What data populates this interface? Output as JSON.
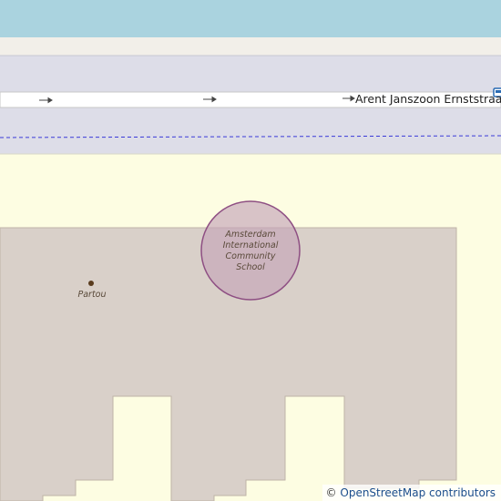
{
  "map": {
    "colors": {
      "water": "#aad3df",
      "road_casing": "#f0eee9",
      "road_band": "#dddde8",
      "street": "#ffffff",
      "railway_dash": "#3a3ad8",
      "residential": "#fdfde2",
      "school_area": "#d9d0c9",
      "school_marker": "#c5a4b8",
      "poi_dot": "#5a3c1e"
    },
    "icons": [
      "oneway-arrow-icon",
      "bus-stop-icon",
      "poi-dot-icon"
    ],
    "street": {
      "name": "Arent Janszoon Ernststraat"
    },
    "pois": {
      "school": "Amsterdam International Community School",
      "childcare": "Partou"
    },
    "attribution": {
      "symbol": "©",
      "text": "OpenStreetMap contributors"
    }
  }
}
